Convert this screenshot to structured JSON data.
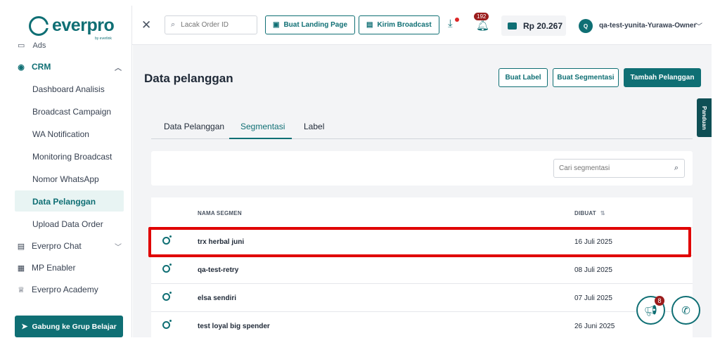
{
  "brand": {
    "name": "everpro",
    "sub": "by everlink"
  },
  "sidebar": {
    "cut_item": "Ads",
    "crm": "CRM",
    "crm_items": [
      "Dashboard Analisis",
      "Broadcast Campaign",
      "WA Notification",
      "Monitoring Broadcast",
      "Nomor WhatsApp",
      "Data Pelanggan",
      "Upload Data Order"
    ],
    "active_item": "Data Pelanggan",
    "groups": [
      "Everpro Chat",
      "MP Enabler",
      "Everpro Academy"
    ],
    "join_label": "Gabung ke Grup Belajar"
  },
  "topbar": {
    "search_placeholder": "Lacak Order ID",
    "landing_label": "Buat Landing Page",
    "broadcast_label": "Kirim Broadcast",
    "notif_count": "192",
    "balance": "Rp 20.267",
    "avatar_initial": "Q",
    "username": "qa-test-yunita-Yurawa-Owner"
  },
  "page": {
    "title": "Data pelanggan",
    "buttons": {
      "label": "Buat Label",
      "segment": "Buat Segmentasi",
      "add": "Tambah Pelanggan"
    },
    "guide": "Panduan"
  },
  "tabs": [
    "Data Pelanggan",
    "Segmentasi",
    "Label"
  ],
  "active_tab": "Segmentasi",
  "segment_search_placeholder": "Cari segmentasi",
  "table": {
    "headers": {
      "name": "NAMA SEGMEN",
      "created": "DIBUAT"
    },
    "rows": [
      {
        "name": "trx herbal juni",
        "date": "16 Juli 2025"
      },
      {
        "name": "qa-test-retry",
        "date": "08 Juli 2025"
      },
      {
        "name": "elsa sendiri",
        "date": "07 Juli 2025"
      },
      {
        "name": "test loyal big spender",
        "date": "26 Juni 2025"
      }
    ]
  },
  "fab": {
    "announce_count": "8"
  },
  "colors": {
    "accent": "#0f6f74",
    "highlight": "#e00000",
    "badge": "#9b1c1c"
  }
}
